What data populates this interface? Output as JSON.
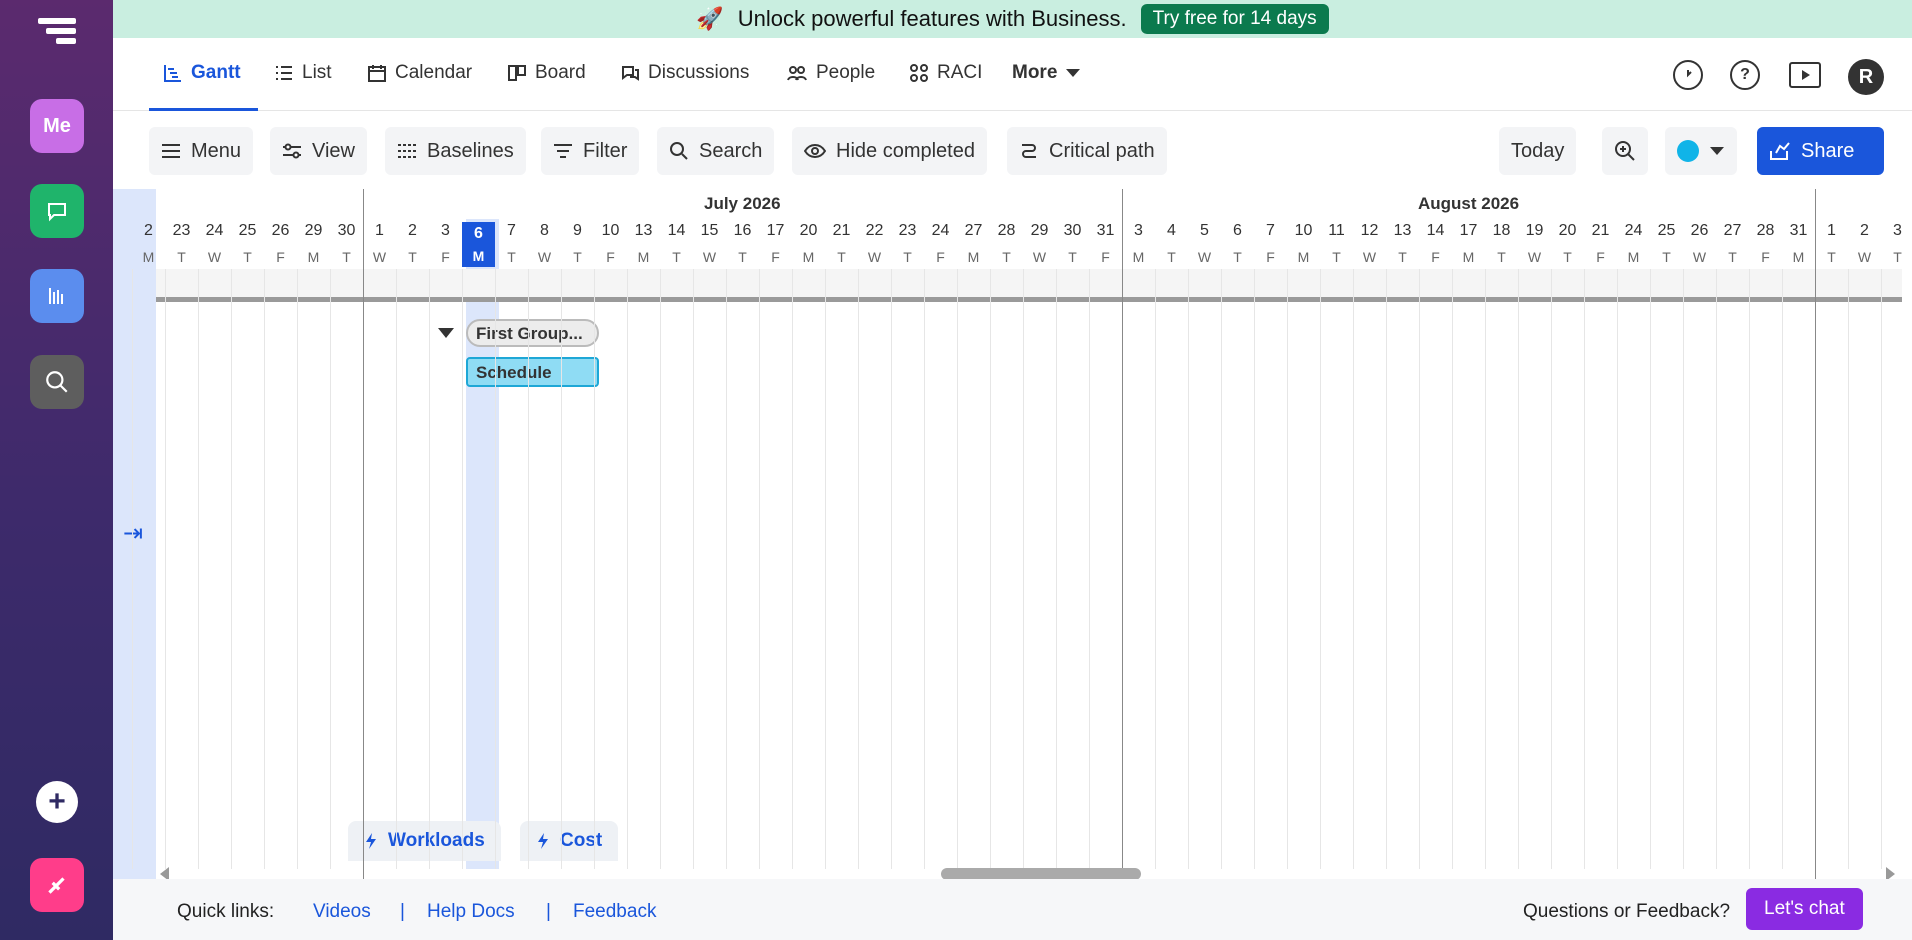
{
  "promo": {
    "emoji": "🚀",
    "text": "Unlock powerful features with Business.",
    "cta": "Try free for 14 days"
  },
  "rail": {
    "me_label": "Me"
  },
  "tabs": [
    {
      "label": "Gantt",
      "icon": "gantt-icon",
      "active": true
    },
    {
      "label": "List",
      "icon": "list-icon"
    },
    {
      "label": "Calendar",
      "icon": "calendar-icon"
    },
    {
      "label": "Board",
      "icon": "board-icon"
    },
    {
      "label": "Discussions",
      "icon": "discussions-icon"
    },
    {
      "label": "People",
      "icon": "people-icon"
    },
    {
      "label": "RACI",
      "icon": "raci-icon"
    },
    {
      "label": "More",
      "icon": "chevron-down-icon"
    }
  ],
  "user_initial": "R",
  "toolbar": {
    "menu": "Menu",
    "view": "View",
    "baselines": "Baselines",
    "filter": "Filter",
    "search": "Search",
    "hide_completed": "Hide completed",
    "critical_path": "Critical path",
    "today": "Today",
    "share": "Share",
    "color": "#10b4e8"
  },
  "timeline": {
    "months": [
      {
        "label": "July 2026"
      },
      {
        "label": "August 2026"
      }
    ],
    "days": [
      "2",
      "23",
      "24",
      "25",
      "26",
      "29",
      "30",
      "1",
      "2",
      "3",
      "6",
      "7",
      "8",
      "9",
      "10",
      "13",
      "14",
      "15",
      "16",
      "17",
      "20",
      "21",
      "22",
      "23",
      "24",
      "27",
      "28",
      "29",
      "30",
      "31",
      "3",
      "4",
      "5",
      "6",
      "7",
      "10",
      "11",
      "12",
      "13",
      "14",
      "17",
      "18",
      "19",
      "20",
      "21",
      "24",
      "25",
      "26",
      "27",
      "28",
      "31",
      "1",
      "2",
      "3"
    ],
    "dows": [
      "M",
      "T",
      "W",
      "T",
      "F",
      "M",
      "T",
      "W",
      "T",
      "F",
      "M",
      "T",
      "W",
      "T",
      "F",
      "M",
      "T",
      "W",
      "T",
      "F",
      "M",
      "T",
      "W",
      "T",
      "F",
      "M",
      "T",
      "W",
      "T",
      "F",
      "M",
      "T",
      "W",
      "T",
      "F",
      "M",
      "T",
      "W",
      "T",
      "F",
      "M",
      "T",
      "W",
      "T",
      "F",
      "M",
      "T",
      "W",
      "T",
      "F",
      "M",
      "T",
      "W",
      "T"
    ],
    "today_day": "6",
    "today_dow": "M"
  },
  "tasks": {
    "group_label": "First Group...",
    "task_label": "Schedule"
  },
  "floating": {
    "workloads": "Workloads",
    "cost": "Cost"
  },
  "footer": {
    "quick_links": "Quick links:",
    "videos": "Videos",
    "help_docs": "Help Docs",
    "feedback": "Feedback",
    "separator": "|",
    "questions": "Questions or Feedback?",
    "chat": "Let's chat"
  }
}
